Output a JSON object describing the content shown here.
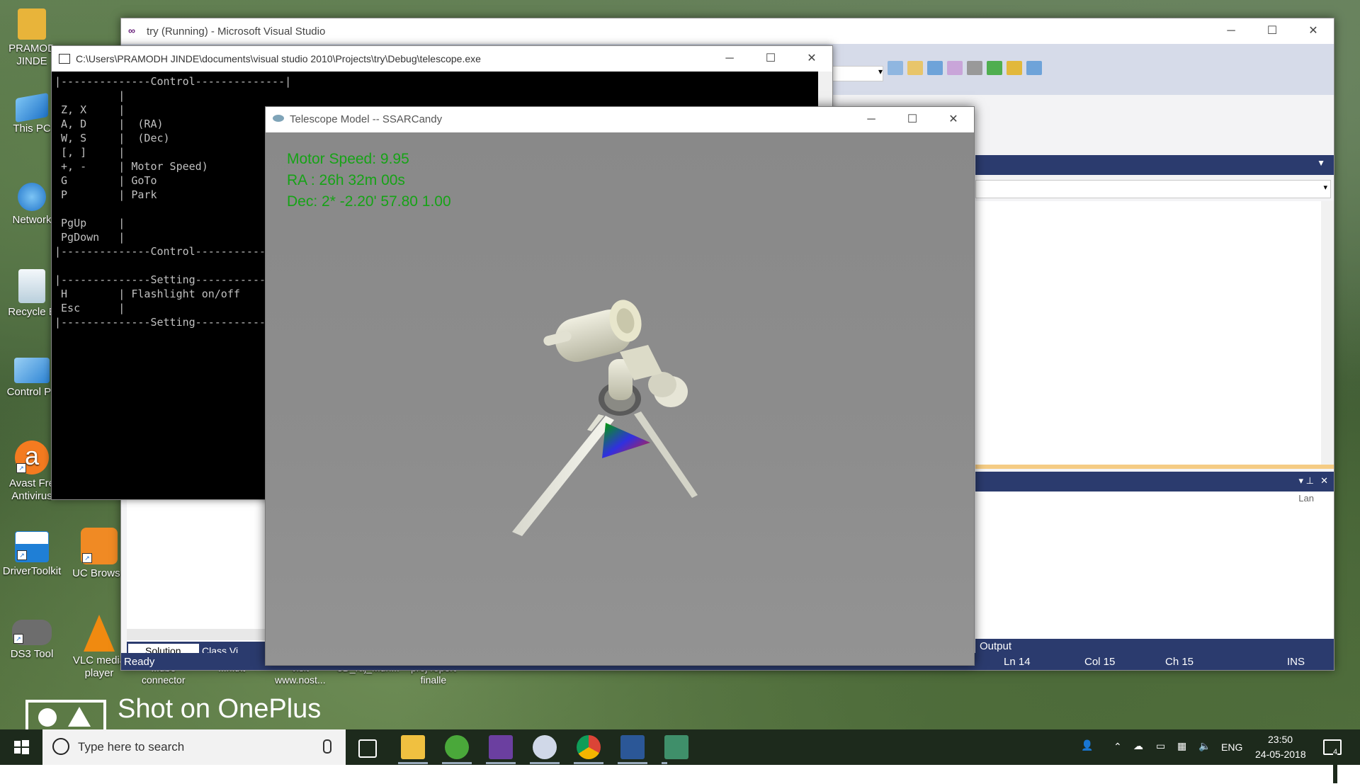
{
  "desktop": {
    "icons": [
      {
        "label": "PRAMOD\nJINDE",
        "color": "#e8b43a"
      },
      {
        "label": "This PC",
        "color": "#3b8fd8"
      },
      {
        "label": "Network",
        "color": "#3b8fd8"
      },
      {
        "label": "Recycle B",
        "color": "#e4eef4"
      },
      {
        "label": "Control Pa",
        "color": "#4a9fe0"
      },
      {
        "label": "Avast Fre\nAntivirus",
        "color": "#f47b20"
      },
      {
        "label": "DriverToolkit",
        "color": "#1f7fd6"
      },
      {
        "label": "UC Browse",
        "color": "#f08a24"
      },
      {
        "label": "DS3 Tool",
        "color": "#777777"
      },
      {
        "label": "VLC media\nplayer",
        "color": "#f08a10"
      }
    ],
    "partial_labels": [
      "...ube\nconnector",
      "...n.txt",
      "visit\nwww.nost...",
      "3D_raj_Mun...",
      "proj report\nfinalle"
    ]
  },
  "visual_studio": {
    "title": "try (Running) - Microsoft Visual Studio",
    "status": {
      "ready": "Ready",
      "ln": "Ln 14",
      "col": "Col 15",
      "ch": "Ch 15",
      "ins": "INS"
    },
    "tabs": [
      "Solution...",
      "Class Vi..."
    ],
    "output_tab": "Output",
    "output_lang": "Lan"
  },
  "console": {
    "title": "C:\\Users\\PRAMODH JINDE\\documents\\visual studio 2010\\Projects\\try\\Debug\\telescope.exe",
    "lines": "|--------------Control--------------|\n          |\n Z, X     |\n A, D     |  (RA)\n W, S     |  (Dec)\n [, ]     |\n +, -     | Motor Speed)\n G        | GoTo\n P        | Park\n\n PgUp     |\n PgDown   |\n|--------------Control--------------|\n\n|--------------Setting--------------|\n H        | Flashlight on/off\n Esc      |\n|--------------Setting--------------|"
  },
  "telescope_window": {
    "title": "Telescope Model -- SSARCandy",
    "hud": {
      "motor_speed": "Motor Speed: 9.95",
      "ra": "RA  : 26h 32m 00s",
      "dec": "Dec: 2* -2.20' 57.80  1.00"
    }
  },
  "watermark": {
    "text": "Shot on OnePlus"
  },
  "taskbar": {
    "search_placeholder": "Type here to search",
    "lang": "ENG",
    "time": "23:50",
    "date": "24-05-2018",
    "notifications": "4"
  }
}
